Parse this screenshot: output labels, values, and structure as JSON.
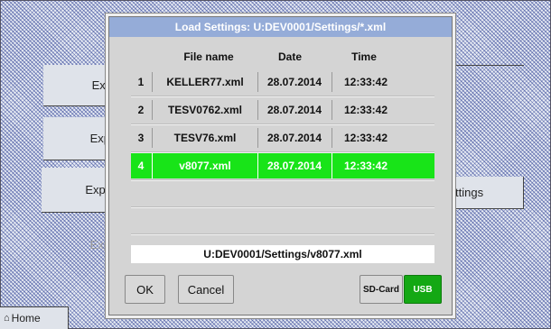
{
  "background": {
    "buttons": [
      "Exp",
      "Exp",
      "Expo",
      "Exp",
      "ttings"
    ],
    "home_label": "Home"
  },
  "dialog": {
    "title": "Load Settings:  U:DEV0001/Settings/*.xml",
    "columns": {
      "file_name": "File name",
      "date": "Date",
      "time": "Time"
    },
    "rows": [
      {
        "index": "1",
        "file_name": "KELLER77.xml",
        "date": "28.07.2014",
        "time": "12:33:42",
        "selected": false
      },
      {
        "index": "2",
        "file_name": "TESV0762.xml",
        "date": "28.07.2014",
        "time": "12:33:42",
        "selected": false
      },
      {
        "index": "3",
        "file_name": "TESV76.xml",
        "date": "28.07.2014",
        "time": "12:33:42",
        "selected": false
      },
      {
        "index": "4",
        "file_name": "v8077.xml",
        "date": "28.07.2014",
        "time": "12:33:42",
        "selected": true
      }
    ],
    "path": "U:DEV0001/Settings/v8077.xml",
    "ok_label": "OK",
    "cancel_label": "Cancel",
    "sdcard_label": "SD-Card",
    "usb_label": "USB",
    "colors": {
      "selected_row": "#18e418",
      "usb_active": "#14a814",
      "title_bar": "#95acd8"
    }
  }
}
